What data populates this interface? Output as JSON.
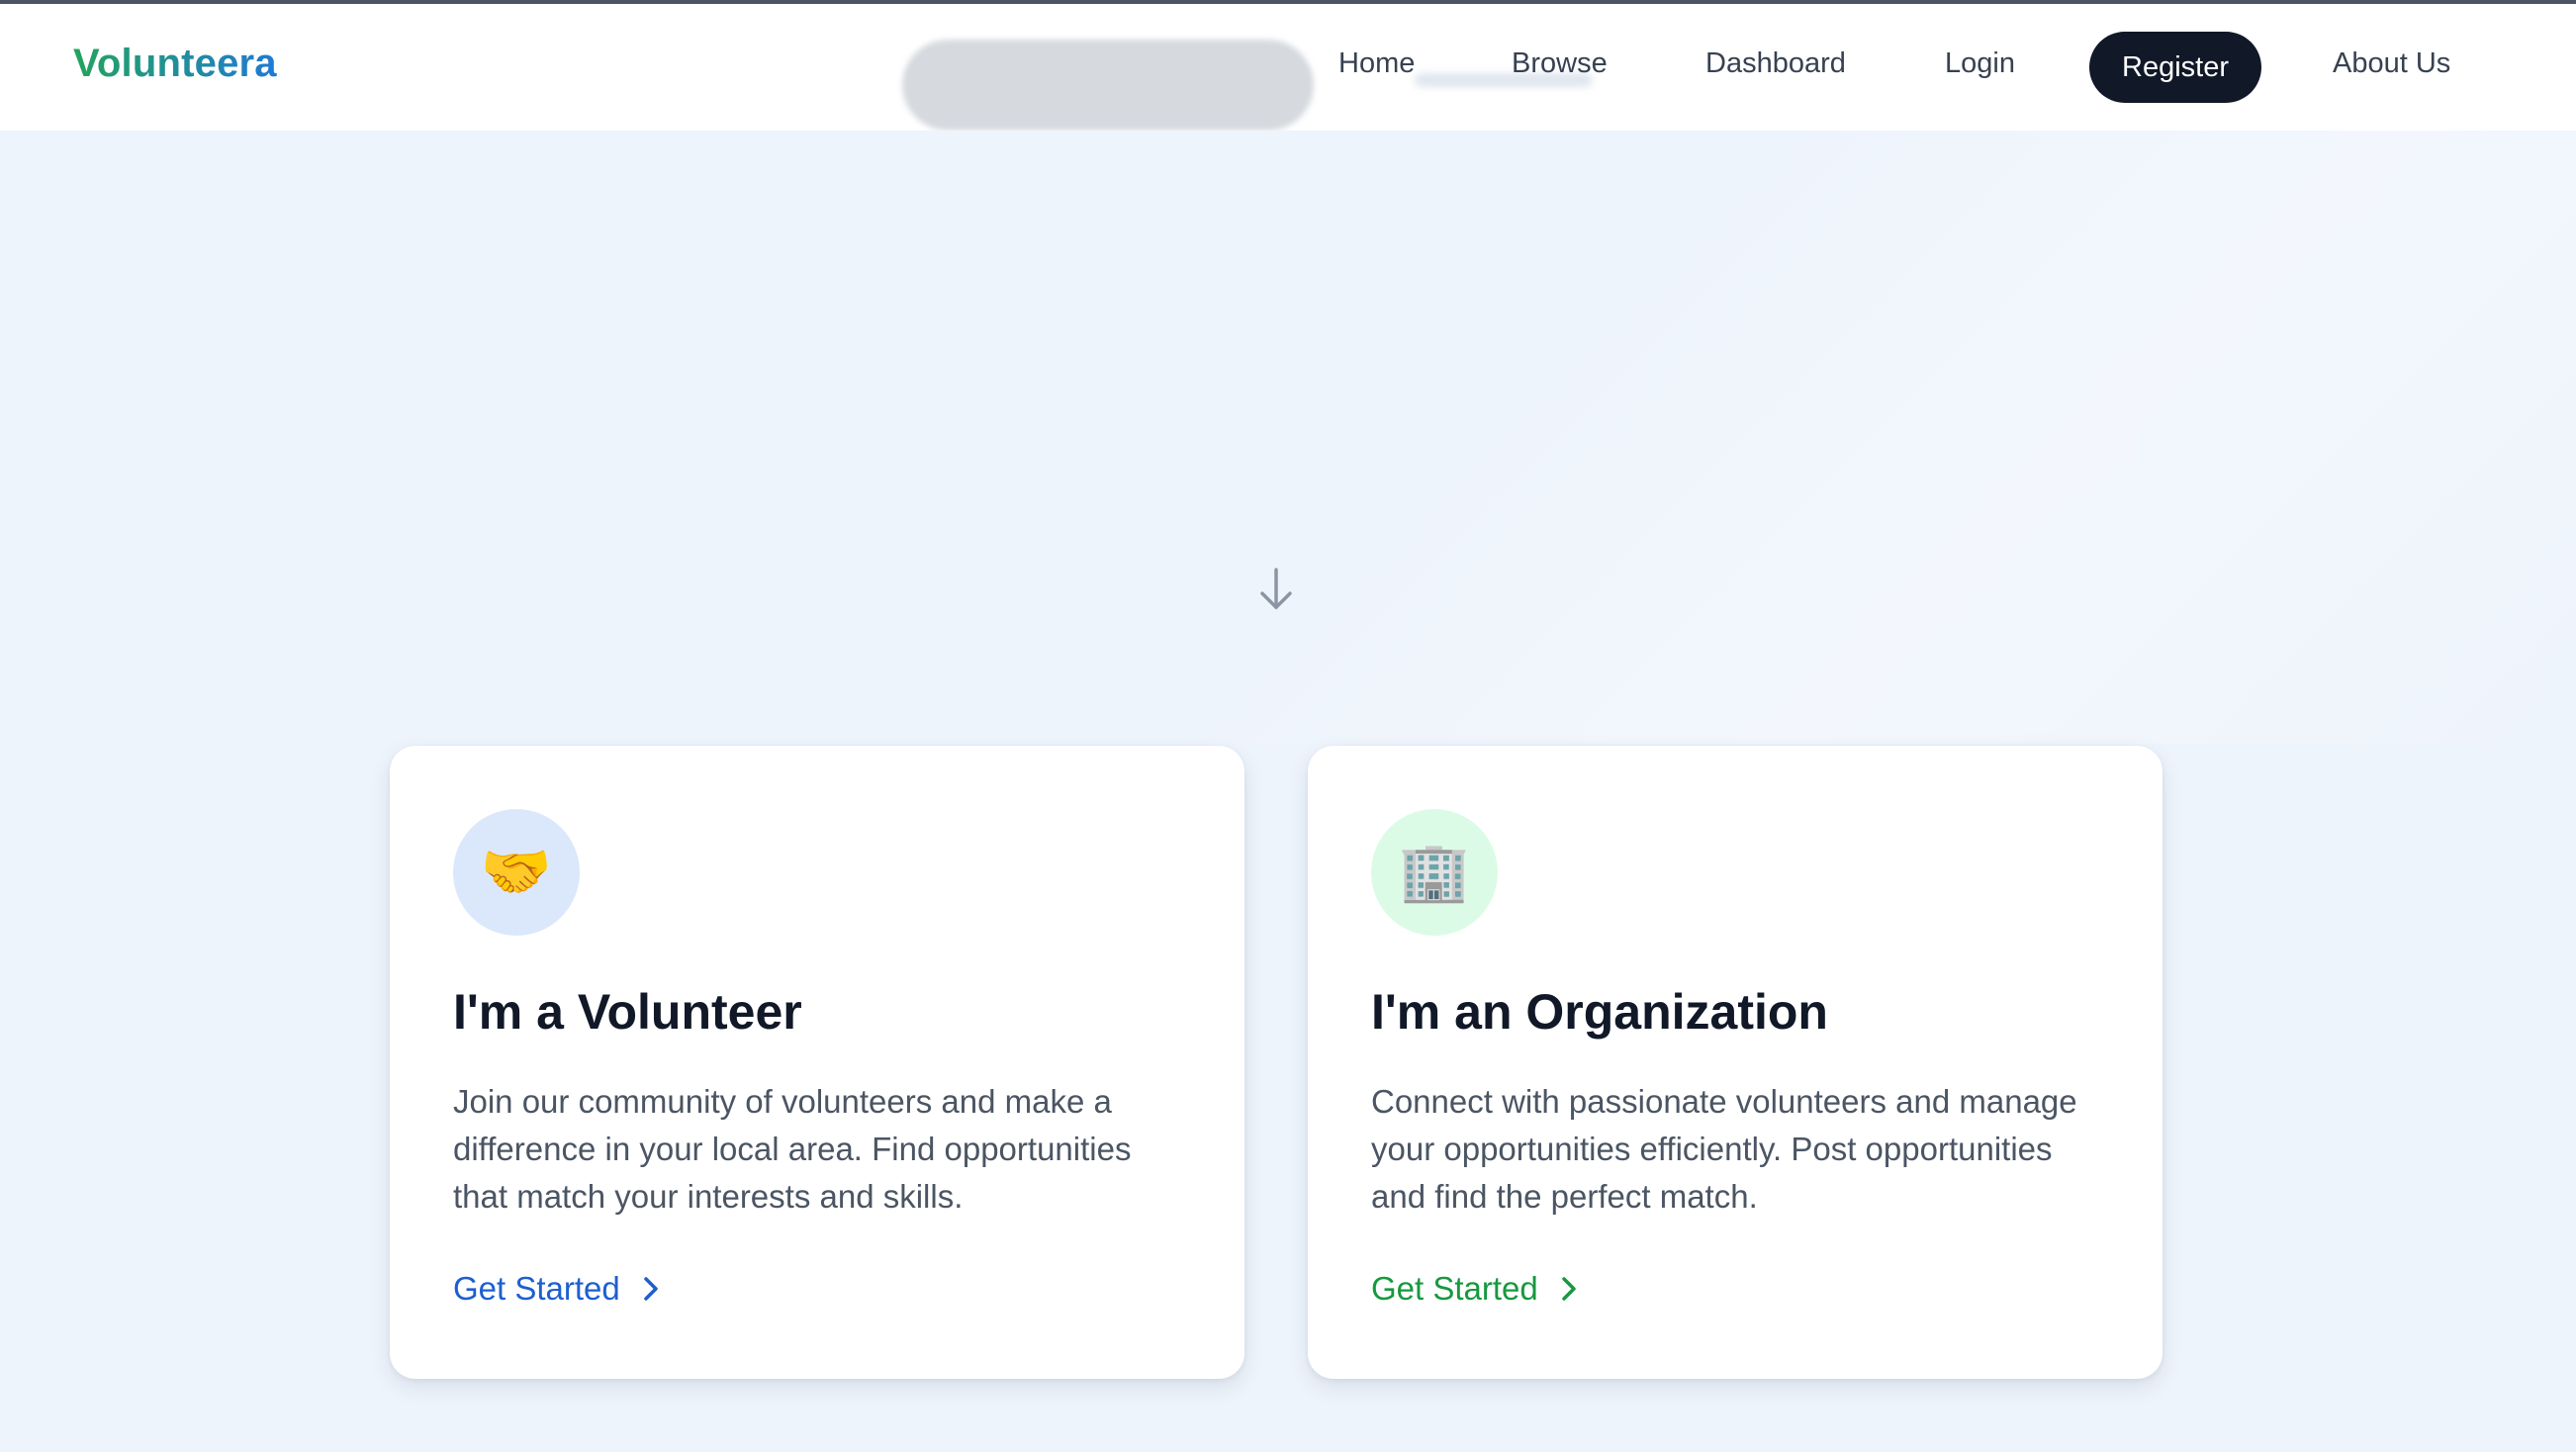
{
  "header": {
    "logo": "Volunteera",
    "nav": {
      "home": "Home",
      "browse": "Browse",
      "dashboard": "Dashboard",
      "login": "Login",
      "register": "Register",
      "about": "About Us"
    }
  },
  "hero": {
    "scroll_icon": "arrow-down-icon"
  },
  "cards": [
    {
      "icon": "handshake-icon",
      "emoji": "🤝",
      "title": "I'm a Volunteer",
      "description": "Join our community of volunteers and make a difference in your local area. Find opportunities that match your interests and skills.",
      "link": "Get Started",
      "accent": "#1d5fd1"
    },
    {
      "icon": "office-building-icon",
      "emoji": "🏢",
      "title": "I'm an Organization",
      "description": "Connect with passionate volunteers and manage your opportunities efficiently. Post opportunities and find the perfect match.",
      "link": "Get Started",
      "accent": "#17993f"
    }
  ],
  "colors": {
    "page_background": "#eef4fc",
    "register_button": "#111827",
    "logo_gradient_start": "#22a45d",
    "logo_gradient_end": "#1f7ad6"
  }
}
